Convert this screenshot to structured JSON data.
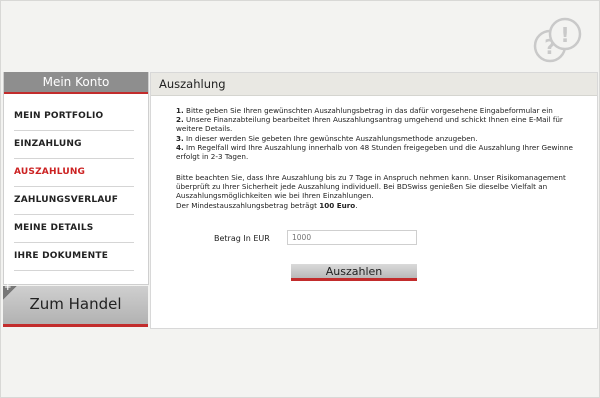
{
  "sidebar": {
    "title": "Mein Konto",
    "items": [
      {
        "label": "MEIN PORTFOLIO",
        "active": false
      },
      {
        "label": "EINZAHLUNG",
        "active": false
      },
      {
        "label": "AUSZAHLUNG",
        "active": true
      },
      {
        "label": "ZAHLUNGSVERLAUF",
        "active": false
      },
      {
        "label": "MEINE DETAILS",
        "active": false
      },
      {
        "label": "IHRE DOKUMENTE",
        "active": false
      }
    ],
    "trade_button": "Zum Handel",
    "trade_corner": "+"
  },
  "main": {
    "title": "Auszahlung",
    "steps": [
      {
        "num": "1.",
        "text": " Bitte geben Sie Ihren gewünschten Auszahlungsbetrag in das dafür vorgesehene Eingabeformular ein"
      },
      {
        "num": "2.",
        "text": " Unsere Finanzabteilung bearbeitet Ihren Auszahlungsantrag umgehend und schickt Ihnen eine E-Mail für weitere Details."
      },
      {
        "num": "3.",
        "text": " In dieser werden Sie gebeten Ihre gewünschte Auszahlungsmethode anzugeben."
      },
      {
        "num": "4.",
        "text": " Im Regelfall wird Ihre Auszahlung innerhalb von 48 Stunden freigegeben und die Auszahlung Ihrer Gewinne erfolgt in 2-3 Tagen."
      }
    ],
    "note": "Bitte beachten Sie, dass Ihre Auszahlung bis zu 7 Tage in Anspruch nehmen kann. Unser Risikomanagement überprüft zu Ihrer Sicherheit jede Auszahlung individuell. Bei BDSwiss genießen Sie dieselbe Vielfalt an Auszahlungsmöglichkeiten wie bei Ihren Einzahlungen.",
    "minimum_prefix": "Der Mindestauszahlungsbetrag beträgt ",
    "minimum_amount": "100 Euro",
    "minimum_suffix": ".",
    "amount_label": "Betrag In EUR",
    "amount_placeholder": "1000",
    "submit_label": "Auszahlen"
  },
  "help_icon": "help-question-exclamation-icon",
  "colors": {
    "accent": "#c22c2c",
    "header_gray": "#8e8e8e",
    "panel_header": "#e9e8e3"
  }
}
